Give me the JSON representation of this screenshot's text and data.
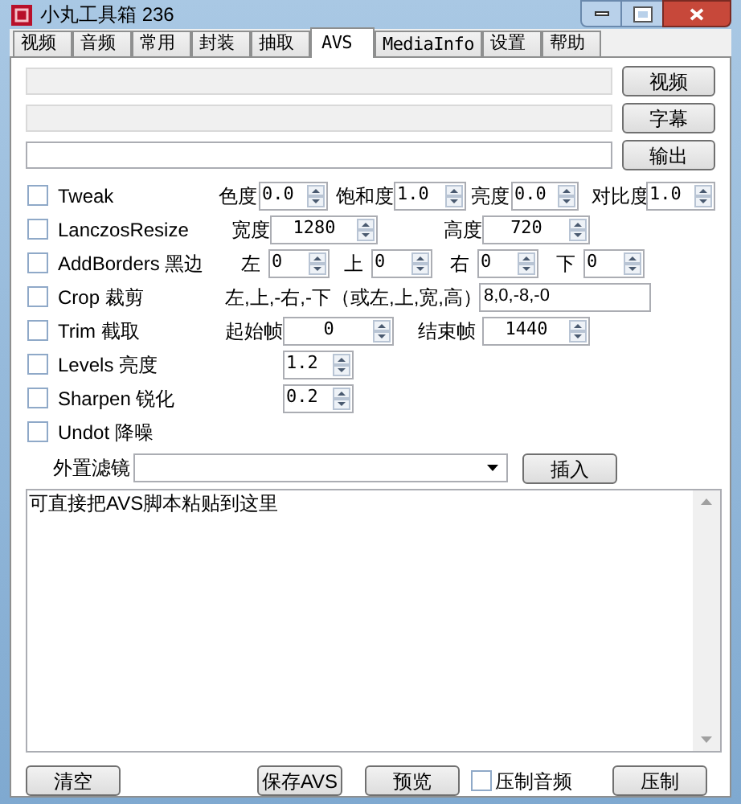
{
  "window": {
    "title": "小丸工具箱 236"
  },
  "tabs": [
    {
      "label": "视频",
      "selected": false
    },
    {
      "label": "音频",
      "selected": false
    },
    {
      "label": "常用",
      "selected": false
    },
    {
      "label": "封装",
      "selected": false
    },
    {
      "label": "抽取",
      "selected": false
    },
    {
      "label": "AVS",
      "selected": true
    },
    {
      "label": "MediaInfo",
      "selected": false
    },
    {
      "label": "设置",
      "selected": false
    },
    {
      "label": "帮助",
      "selected": false
    }
  ],
  "file_rows": [
    {
      "disabled": true,
      "button": "视频"
    },
    {
      "disabled": true,
      "button": "字幕"
    },
    {
      "disabled": false,
      "button": "输出"
    }
  ],
  "filters": [
    {
      "kind": "tweak",
      "label": "Tweak",
      "checked": false,
      "params": [
        {
          "label": "色度",
          "value": "0.0"
        },
        {
          "label": "饱和度",
          "value": "1.0"
        },
        {
          "label": "亮度",
          "value": "0.0"
        },
        {
          "label": "对比度",
          "value": "1.0"
        }
      ]
    },
    {
      "kind": "resize",
      "label": "LanczosResize",
      "checked": false,
      "params": [
        {
          "label": "宽度",
          "value": "1280"
        },
        {
          "label": "高度",
          "value": "720"
        }
      ]
    },
    {
      "kind": "borders",
      "label": "AddBorders 黑边",
      "checked": false,
      "params": [
        {
          "label": "左",
          "value": "0"
        },
        {
          "label": "上",
          "value": "0"
        },
        {
          "label": "右",
          "value": "0"
        },
        {
          "label": "下",
          "value": "0"
        }
      ]
    },
    {
      "kind": "crop",
      "label": "Crop 裁剪",
      "checked": false,
      "params": [
        {
          "label": "左,上,-右,-下（或左,上,宽,高）",
          "value": "8,0,-8,-0"
        }
      ]
    },
    {
      "kind": "trim",
      "label": "Trim 截取",
      "checked": false,
      "params": [
        {
          "label": "起始帧",
          "value": "0"
        },
        {
          "label": "结束帧",
          "value": "1440"
        }
      ]
    },
    {
      "kind": "single",
      "label": "Levels 亮度",
      "checked": false,
      "params": [
        {
          "value": "1.2"
        }
      ]
    },
    {
      "kind": "single",
      "label": "Sharpen 锐化",
      "checked": false,
      "params": [
        {
          "value": "0.2"
        }
      ]
    },
    {
      "kind": "none",
      "label": "Undot 降噪",
      "checked": false
    }
  ],
  "external_filter": {
    "label": "外置滤镜",
    "button": "插入"
  },
  "script": {
    "value": "可直接把AVS脚本粘贴到这里"
  },
  "bottom": {
    "clear": "清空",
    "save": "保存AVS",
    "preview": "预览",
    "audio": {
      "label": "压制音频",
      "checked": false
    },
    "encode": "压制"
  }
}
